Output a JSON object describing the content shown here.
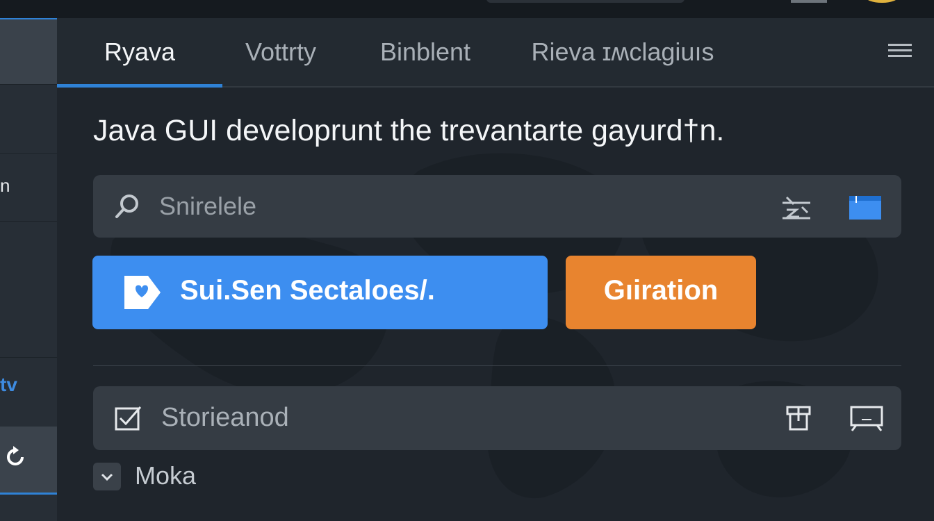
{
  "tabs": [
    {
      "label": "Ryava",
      "active": true
    },
    {
      "label": "Vottrty",
      "active": false
    },
    {
      "label": "Binblent",
      "active": false
    },
    {
      "label": "Rieva ɪʍclagiuıs",
      "active": false
    }
  ],
  "heading": "Java GUI developrunt the trevantarte gayurd†n.",
  "search": {
    "placeholder": "Snirelele"
  },
  "actions": {
    "primary_label": "Sui.Sen Sectaloes/.",
    "secondary_label": "Gıiration"
  },
  "row": {
    "label": "Storieanod"
  },
  "dropdown": {
    "label": "Moka"
  },
  "sidebar": {
    "text_item": "n",
    "accent_item": "tv"
  },
  "colors": {
    "accent_blue": "#3d8ef0",
    "accent_orange": "#e8842f",
    "background": "#1f252c",
    "panel": "#353c44"
  },
  "icons": [
    "search-icon",
    "filter-icon",
    "panel-icon",
    "checkbox-icon",
    "box-icon",
    "screen-icon",
    "chevron-down-icon",
    "refresh-icon",
    "heart-icon",
    "menu-icon"
  ]
}
